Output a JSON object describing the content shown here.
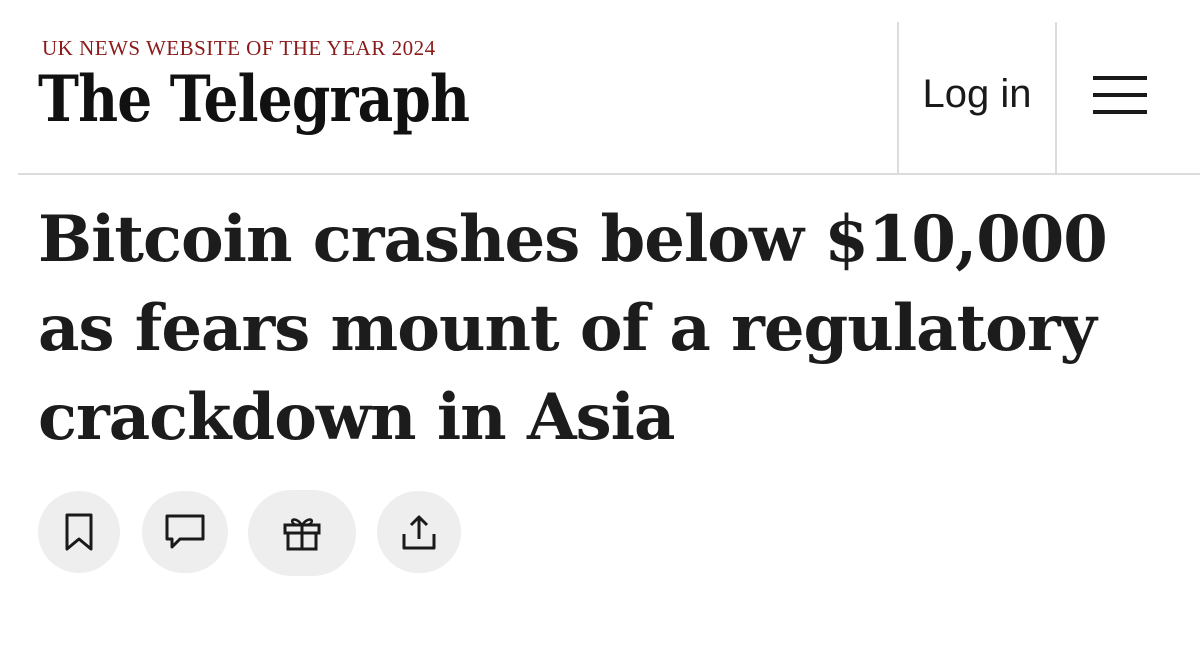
{
  "header": {
    "tagline": "UK NEWS WEBSITE OF THE YEAR 2024",
    "masthead": "The Telegraph",
    "login_label": "Log in",
    "menu_icon": "hamburger-menu-icon"
  },
  "article": {
    "headline": "Bitcoin crashes below $10,000 as fears mount of a regulatory crackdown in Asia"
  },
  "actions": [
    {
      "name": "bookmark",
      "icon": "bookmark-icon"
    },
    {
      "name": "comment",
      "icon": "comment-icon"
    },
    {
      "name": "gift",
      "icon": "gift-icon"
    },
    {
      "name": "share",
      "icon": "share-icon"
    }
  ],
  "colors": {
    "tagline": "#8b1a1a",
    "text": "#1a1a1a",
    "button_bg": "#eeeeee",
    "divider": "#dcdcdc"
  }
}
